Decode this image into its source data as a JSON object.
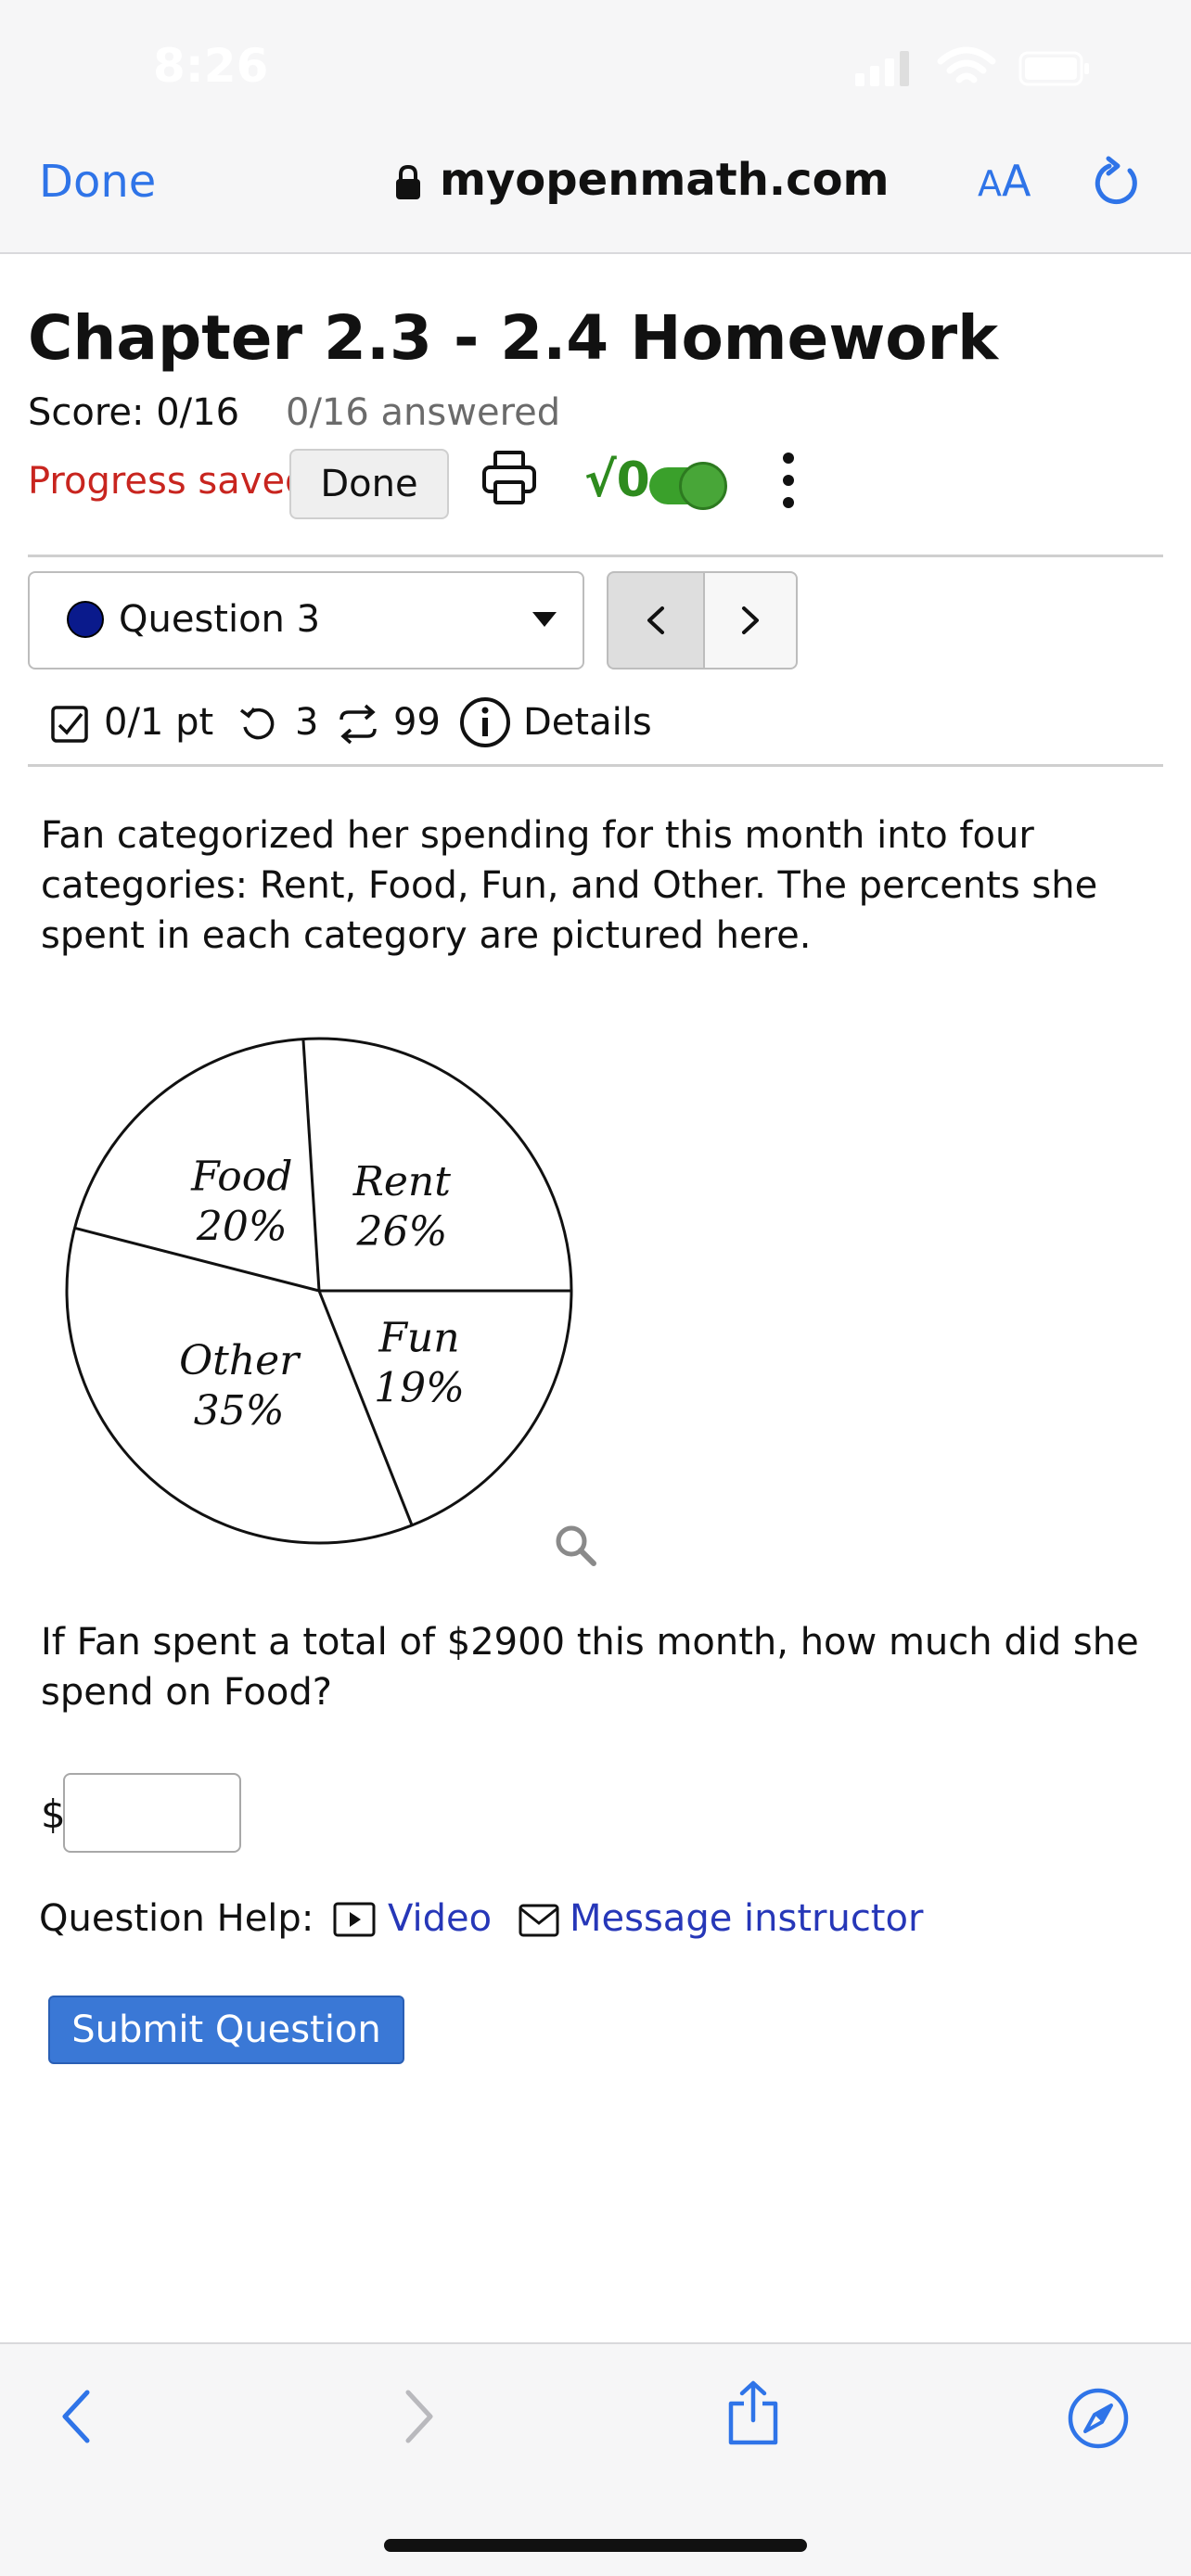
{
  "status_bar": {
    "time": "8:26"
  },
  "browser": {
    "done_label": "Done",
    "url": "myopenmath.com",
    "text_size_label_small": "A",
    "text_size_label_large": "A"
  },
  "assignment": {
    "title": "Chapter 2.3 - 2.4 Homework",
    "score": "Score: 0/16",
    "answered": "0/16 answered",
    "progress": "Progress saved",
    "done_button": "Done",
    "sqrt_symbol": "√0"
  },
  "question_nav": {
    "selected": "Question 3",
    "prev_symbol": "<",
    "next_symbol": ">"
  },
  "meta": {
    "points": "0/1 pt",
    "attempts": "3",
    "versions": "99",
    "details": "Details"
  },
  "question": {
    "intro": "Fan categorized her spending for this month into four categories: Rent, Food, Fun, and Other. The percents she spent in each category are pictured here.",
    "prompt": "If Fan spent a total of $2900 this month, how much did she spend on Food?",
    "currency": "$",
    "answer_value": ""
  },
  "chart_data": {
    "type": "pie",
    "title": "",
    "categories": [
      "Rent",
      "Food",
      "Other",
      "Fun"
    ],
    "values": [
      26,
      20,
      35,
      19
    ],
    "labels": [
      "Rent",
      "Food",
      "Other",
      "Fun"
    ],
    "percent_labels": [
      "26%",
      "20%",
      "35%",
      "19%"
    ],
    "legend": "none"
  },
  "help": {
    "label": "Question Help:",
    "video": "Video",
    "message": "Message instructor"
  },
  "submit_label": "Submit Question",
  "colors": {
    "browser_blue": "#2f74e8",
    "progress_red": "#c8251f",
    "toggle_green": "#3aa02b",
    "link_blue": "#2637b8",
    "submit_blue": "#3a78d6"
  }
}
